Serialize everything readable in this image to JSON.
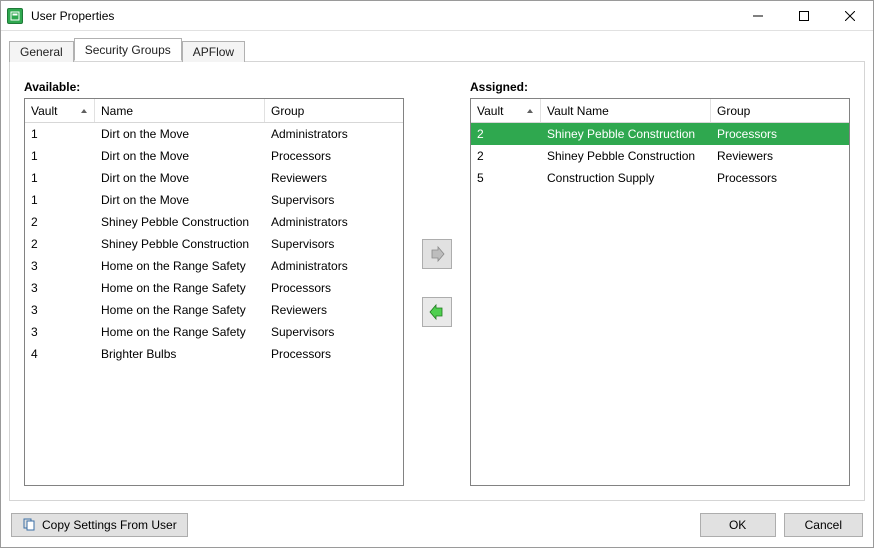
{
  "window": {
    "title": "User Properties"
  },
  "tabs": [
    {
      "label": "General",
      "active": false
    },
    {
      "label": "Security Groups",
      "active": true
    },
    {
      "label": "APFlow",
      "active": false
    }
  ],
  "available": {
    "label": "Available:",
    "headers": {
      "vault": "Vault",
      "name": "Name",
      "group": "Group"
    },
    "rows": [
      {
        "vault": "1",
        "name": "Dirt on the Move",
        "group": "Administrators"
      },
      {
        "vault": "1",
        "name": "Dirt on the Move",
        "group": "Processors"
      },
      {
        "vault": "1",
        "name": "Dirt on the Move",
        "group": "Reviewers"
      },
      {
        "vault": "1",
        "name": "Dirt on the Move",
        "group": "Supervisors"
      },
      {
        "vault": "2",
        "name": "Shiney Pebble Construction",
        "group": "Administrators"
      },
      {
        "vault": "2",
        "name": "Shiney Pebble Construction",
        "group": "Supervisors"
      },
      {
        "vault": "3",
        "name": "Home on the Range Safety",
        "group": "Administrators"
      },
      {
        "vault": "3",
        "name": "Home on the Range Safety",
        "group": "Processors"
      },
      {
        "vault": "3",
        "name": "Home on the Range Safety",
        "group": "Reviewers"
      },
      {
        "vault": "3",
        "name": "Home on the Range Safety",
        "group": "Supervisors"
      },
      {
        "vault": "4",
        "name": "Brighter Bulbs",
        "group": "Processors"
      }
    ]
  },
  "assigned": {
    "label": "Assigned:",
    "headers": {
      "vault": "Vault",
      "name": "Vault Name",
      "group": "Group"
    },
    "rows": [
      {
        "vault": "2",
        "name": "Shiney Pebble Construction",
        "group": "Processors",
        "selected": true
      },
      {
        "vault": "2",
        "name": "Shiney Pebble Construction",
        "group": "Reviewers",
        "selected": false
      },
      {
        "vault": "5",
        "name": "Construction Supply",
        "group": "Processors",
        "selected": false
      }
    ]
  },
  "buttons": {
    "copy": "Copy Settings From User",
    "ok": "OK",
    "cancel": "Cancel"
  }
}
